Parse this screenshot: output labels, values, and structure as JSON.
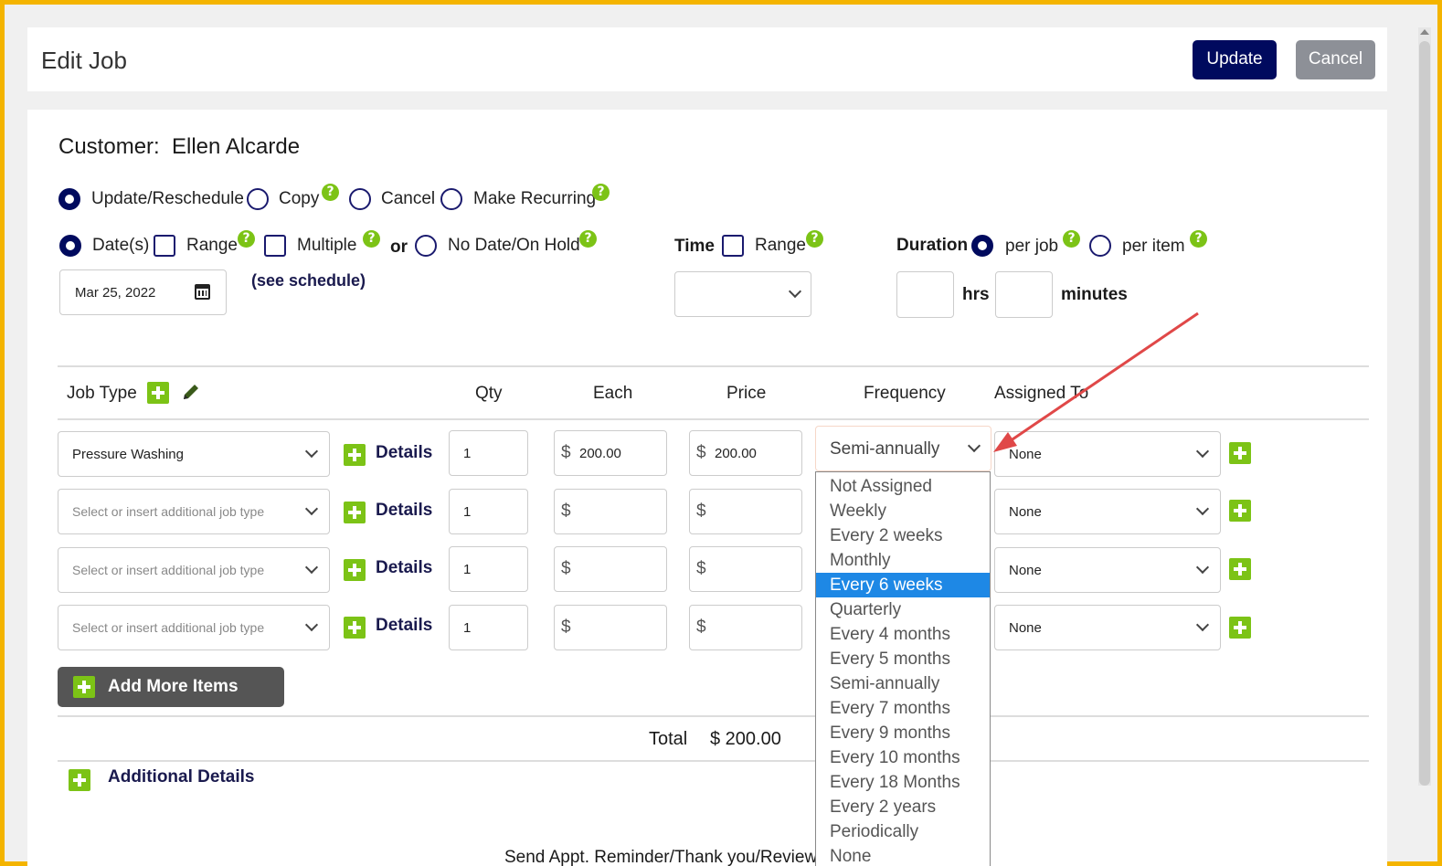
{
  "header": {
    "title": "Edit Job",
    "update_label": "Update",
    "cancel_label": "Cancel"
  },
  "customer": {
    "label": "Customer:",
    "name": "Ellen Alcarde"
  },
  "action_options": [
    {
      "label": "Update/Reschedule",
      "selected": true
    },
    {
      "label": "Copy",
      "help": true
    },
    {
      "label": "Cancel"
    },
    {
      "label": "Make Recurring",
      "help": true
    }
  ],
  "date_options": {
    "dates_label": "Date(s)",
    "range_label": "Range",
    "multiple_label": "Multiple",
    "or_label": "or",
    "no_date_label": "No Date/On Hold",
    "date_value": "Mar 25, 2022",
    "see_schedule": "(see schedule)"
  },
  "time": {
    "label": "Time",
    "range_label": "Range"
  },
  "duration": {
    "label": "Duration",
    "per_job_label": "per job",
    "per_item_label": "per item",
    "hrs_label": "hrs",
    "minutes_label": "minutes"
  },
  "columns": {
    "job_type": "Job Type",
    "qty": "Qty",
    "each": "Each",
    "price": "Price",
    "frequency": "Frequency",
    "assigned_to": "Assigned To"
  },
  "rows": [
    {
      "job_type": "Pressure Washing",
      "details": "Details",
      "qty": "1",
      "currency": "$",
      "each": "200.00",
      "price": "200.00",
      "frequency": "Semi-annually",
      "assigned": "None"
    },
    {
      "job_type_placeholder": "Select or insert additional job type",
      "details": "Details",
      "qty": "1",
      "currency": "$",
      "each": "",
      "price": "",
      "assigned": "None"
    },
    {
      "job_type_placeholder": "Select or insert additional job type",
      "details": "Details",
      "qty": "1",
      "currency": "$",
      "each": "",
      "price": "",
      "assigned": "None"
    },
    {
      "job_type_placeholder": "Select or insert additional job type",
      "details": "Details",
      "qty": "1",
      "currency": "$",
      "each": "",
      "price": "",
      "assigned": "None"
    }
  ],
  "add_more_label": "Add More Items",
  "total": {
    "label": "Total",
    "value": "$ 200.00"
  },
  "additional_details_label": "Additional Details",
  "footer_text": "Send Appt. Reminder/Thank you/Review:",
  "frequency_dropdown": {
    "selected": "Every 6 weeks",
    "options": [
      "Not Assigned",
      "Weekly",
      "Every 2 weeks",
      "Monthly",
      "Every 6 weeks",
      "Quarterly",
      "Every 4 months",
      "Every 5 months",
      "Semi-annually",
      "Every 7 months",
      "Every 9 months",
      "Every 10 months",
      "Every 18 Months",
      "Every 2 years",
      "Periodically",
      "None"
    ]
  },
  "colors": {
    "primary": "#000a5e",
    "secondary": "#8d9097",
    "accent_green": "#7cc316",
    "highlight_blue": "#1e88e5",
    "annotation_red": "#e04848",
    "frame": "#f4b400"
  }
}
